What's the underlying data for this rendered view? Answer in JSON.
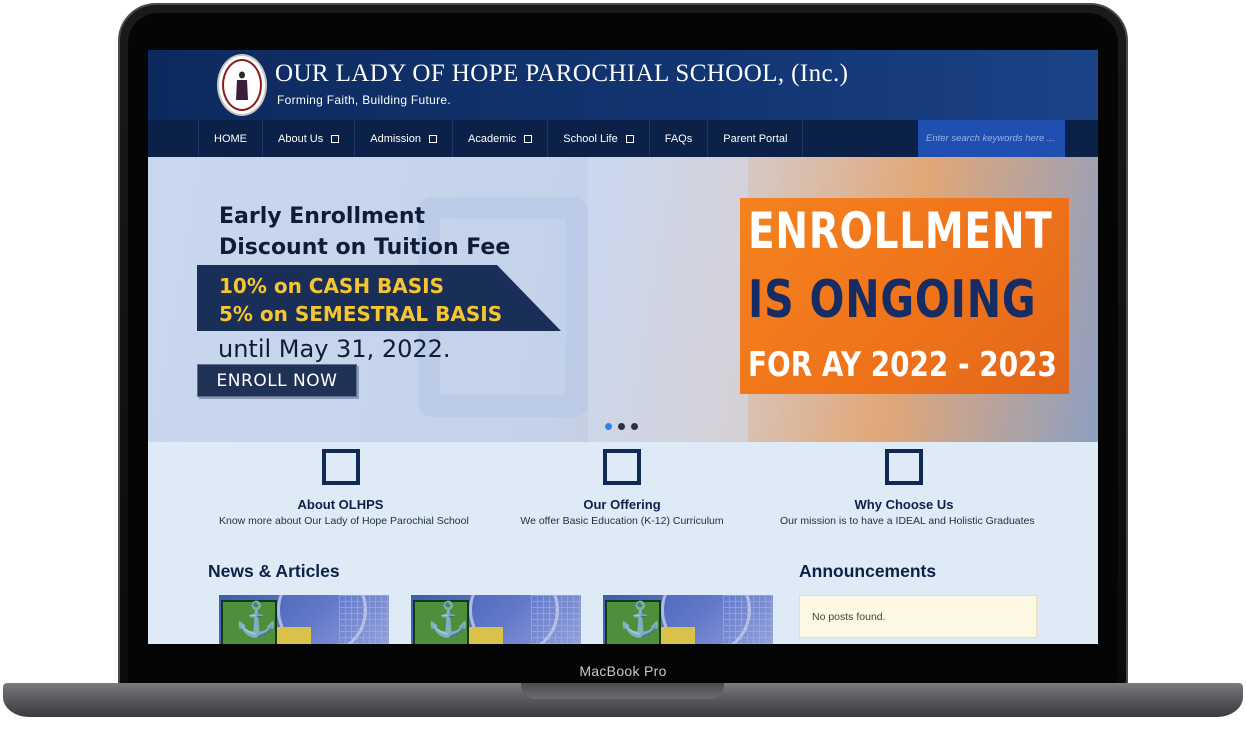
{
  "device": {
    "model_label": "MacBook Pro"
  },
  "site": {
    "title": "OUR LADY OF HOPE PAROCHIAL SCHOOL, (Inc.)",
    "tagline": "Forming Faith, Building Future."
  },
  "nav": {
    "items": [
      {
        "label": "HOME",
        "has_dropdown": false
      },
      {
        "label": "About Us",
        "has_dropdown": true
      },
      {
        "label": "Admission",
        "has_dropdown": true
      },
      {
        "label": "Academic",
        "has_dropdown": true
      },
      {
        "label": "School Life",
        "has_dropdown": true
      },
      {
        "label": "FAQs",
        "has_dropdown": false
      },
      {
        "label": "Parent Portal",
        "has_dropdown": false
      }
    ],
    "search_placeholder": "Enter search keywords here ..."
  },
  "hero": {
    "promo_line1": "Early Enrollment",
    "promo_line2": "Discount on Tuition Fee",
    "promo_cash": "10% on CASH BASIS",
    "promo_semestral": "5% on SEMESTRAL BASIS",
    "promo_until": "until May 31, 2022.",
    "enroll_button": "ENROLL NOW",
    "banner_line1": "ENROLLMENT",
    "banner_line2": "IS ONGOING",
    "banner_line3": "FOR AY 2022 - 2023",
    "slide_count": 3,
    "active_slide": 1
  },
  "features": [
    {
      "title": "About OLHPS",
      "description": "Know more about Our Lady of Hope Parochial School"
    },
    {
      "title": "Our Offering",
      "description": "We offer Basic Education (K-12) Curriculum"
    },
    {
      "title": "Why Choose Us",
      "description": "Our mission is to have a IDEAL and Holistic Graduates"
    }
  ],
  "news": {
    "heading": "News & Articles"
  },
  "announcements": {
    "heading": "Announcements",
    "empty_text": "No posts found."
  },
  "colors": {
    "header_navy": "#0d2a5e",
    "nav_navy": "#0c2148",
    "search_blue": "#1f4fb0",
    "banner_orange": "#f48220",
    "promo_gold": "#f7c530",
    "page_bg": "#dfeaf7"
  }
}
